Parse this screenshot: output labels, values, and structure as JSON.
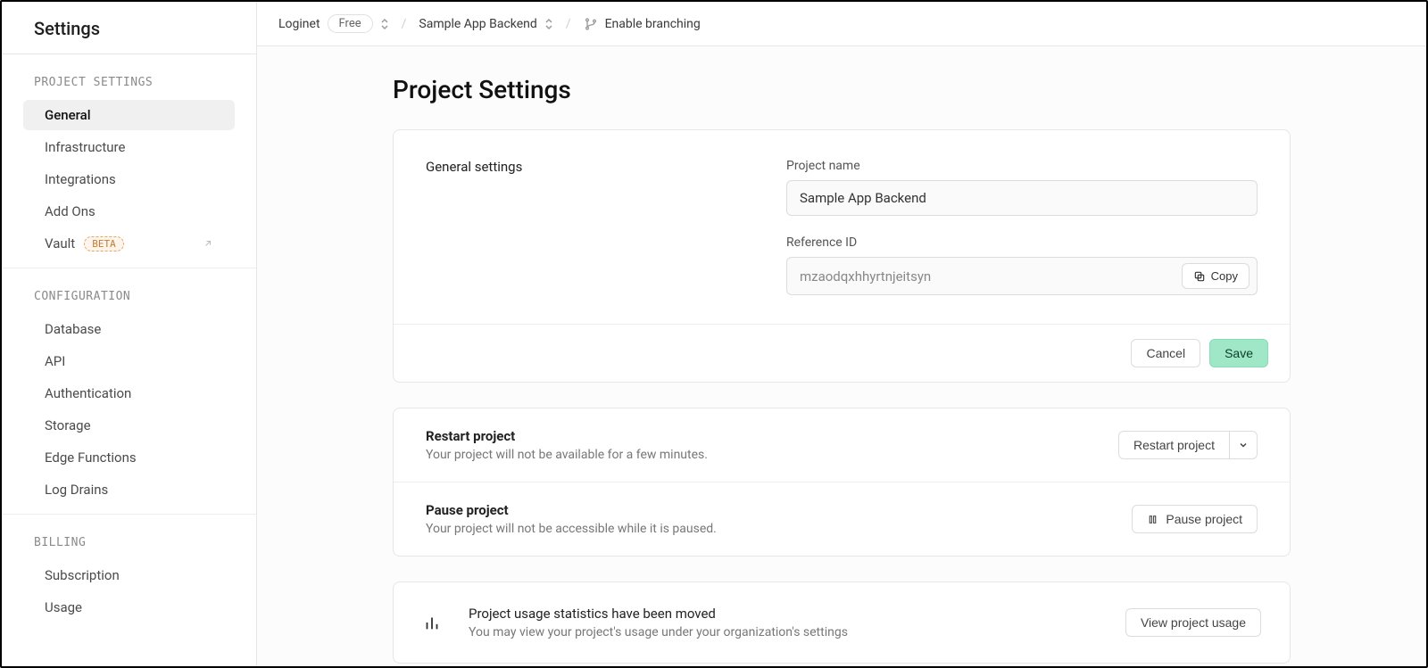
{
  "sidebar": {
    "title": "Settings",
    "sections": [
      {
        "heading": "PROJECT SETTINGS",
        "items": [
          {
            "label": "General",
            "active": true
          },
          {
            "label": "Infrastructure"
          },
          {
            "label": "Integrations"
          },
          {
            "label": "Add Ons"
          },
          {
            "label": "Vault",
            "badge": "BETA",
            "external": true
          }
        ]
      },
      {
        "heading": "CONFIGURATION",
        "items": [
          {
            "label": "Database"
          },
          {
            "label": "API"
          },
          {
            "label": "Authentication"
          },
          {
            "label": "Storage"
          },
          {
            "label": "Edge Functions"
          },
          {
            "label": "Log Drains"
          }
        ]
      },
      {
        "heading": "BILLING",
        "items": [
          {
            "label": "Subscription"
          },
          {
            "label": "Usage"
          }
        ]
      }
    ]
  },
  "breadcrumb": {
    "org": "Loginet",
    "plan": "Free",
    "project": "Sample App Backend",
    "branching": "Enable branching"
  },
  "page": {
    "title": "Project Settings",
    "general": {
      "heading": "General settings",
      "project_name_label": "Project name",
      "project_name_value": "Sample App Backend",
      "reference_id_label": "Reference ID",
      "reference_id_value": "mzaodqxhhyrtnjeitsyn",
      "copy_label": "Copy",
      "cancel_label": "Cancel",
      "save_label": "Save"
    },
    "restart": {
      "title": "Restart project",
      "desc": "Your project will not be available for a few minutes.",
      "button": "Restart project"
    },
    "pause": {
      "title": "Pause project",
      "desc": "Your project will not be accessible while it is paused.",
      "button": "Pause project"
    },
    "usage_info": {
      "title": "Project usage statistics have been moved",
      "desc": "You may view your project's usage under your organization's settings",
      "button": "View project usage"
    }
  }
}
